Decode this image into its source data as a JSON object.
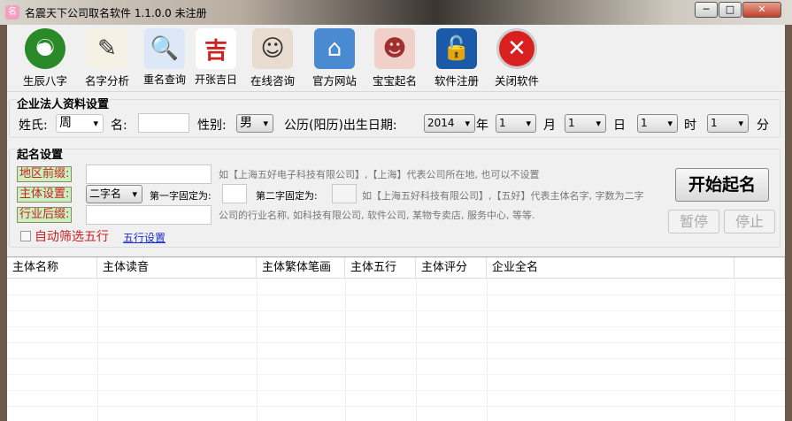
{
  "window": {
    "title": "名震天下公司取名软件 1.1.0.0 未注册",
    "minimize": "─",
    "maximize": "□",
    "close": "✕"
  },
  "toolbar": [
    {
      "label": "生辰八字",
      "icon": "yin-yang-icon"
    },
    {
      "label": "名字分析",
      "icon": "pencil-icon"
    },
    {
      "label": "重名查询",
      "icon": "magnifier-icon"
    },
    {
      "label": "开张吉日",
      "icon": "calligraphy-icon"
    },
    {
      "label": "在线咨询",
      "icon": "headset-agent-icon"
    },
    {
      "label": "官方网站",
      "icon": "house-icon"
    },
    {
      "label": "宝宝起名",
      "icon": "baby-icon"
    },
    {
      "label": "软件注册",
      "icon": "lock-icon"
    },
    {
      "label": "关闭软件",
      "icon": "close-circle-icon"
    }
  ],
  "person": {
    "title": "企业法人资料设置",
    "surname_label": "姓氏:",
    "surname": "周",
    "name_label": "名:",
    "name": "",
    "gender_label": "性别:",
    "gender": "男",
    "date_label": "公历(阳历)出生日期:",
    "year": "2014",
    "year_unit": "年",
    "month": "1",
    "month_unit": "月",
    "day": "1",
    "day_unit": "日",
    "hour": "1",
    "hour_unit": "时",
    "minute": "1",
    "minute_unit": "分"
  },
  "naming": {
    "title": "起名设置",
    "region_label": "地区前缀:",
    "region": "",
    "region_hint": "如【上海五好电子科技有限公司】,【上海】代表公司所在地, 也可以不设置",
    "subject_label": "主体设置:",
    "subject_type": "二字名",
    "first_fixed_label": "第一字固定为:",
    "first_fixed": "",
    "second_fixed_label": "第二字固定为:",
    "second_fixed": "",
    "subject_hint": "如【上海五好科技有限公司】,【五好】代表主体名字, 字数为二字",
    "suffix_label": "行业后缀:",
    "suffix": "",
    "suffix_hint": "公司的行业名称, 如科技有限公司, 软件公司, 某物专卖店, 服务中心, 等等.",
    "auto_filter_label": "自动筛选五行",
    "auto_filter_checked": false,
    "wuxing_link": "五行设置",
    "start_button": "开始起名",
    "pause_button": "暂停",
    "stop_button": "停止"
  },
  "table": {
    "columns": [
      "主体名称",
      "主体读音",
      "主体繁体笔画",
      "主体五行",
      "主体评分",
      "企业全名"
    ],
    "rows": []
  }
}
